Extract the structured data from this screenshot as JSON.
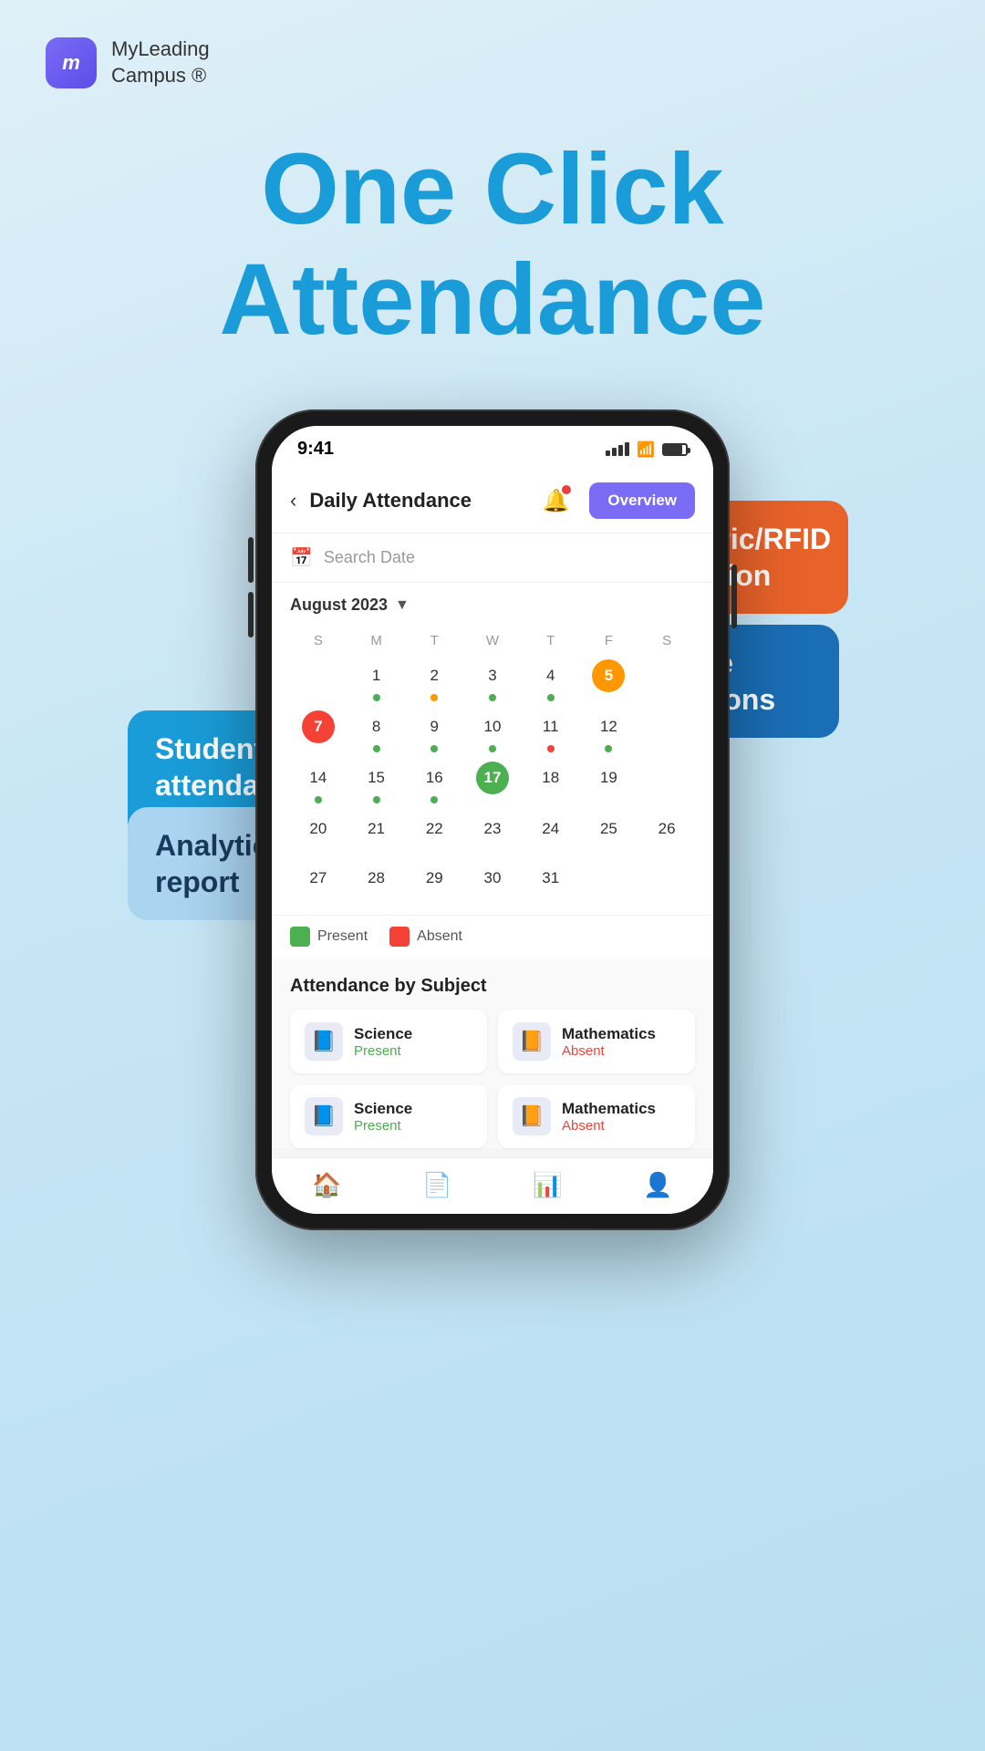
{
  "logo": {
    "icon_letter": "m",
    "text_line1": "MyLeading",
    "text_line2": "Campus ®"
  },
  "hero": {
    "line1": "One Click",
    "line2": "Attendance"
  },
  "phone": {
    "status_time": "9:41",
    "app_title": "Daily Attendance",
    "overview_btn": "Overview",
    "search_placeholder": "Search Date",
    "month_label": "August 2023",
    "day_headers": [
      "S",
      "M",
      "T",
      "W",
      "T",
      "F",
      "S"
    ],
    "legend_present": "Present",
    "legend_absent": "Absent",
    "by_subject_title": "Attendance by Subject",
    "subjects": [
      {
        "name": "Science",
        "status": "Present",
        "status_type": "present"
      },
      {
        "name": "Mathematics",
        "status": "Absent",
        "status_type": "absent"
      },
      {
        "name": "Science",
        "status": "Present",
        "status_type": "present"
      },
      {
        "name": "Mathematics",
        "status": "Absent",
        "status_type": "absent"
      }
    ]
  },
  "bubbles": {
    "biometric": "Biometric/RFID integration",
    "student": "Student attendance tracking",
    "absentee": "Absentee notifications",
    "analytical": "Analytical report"
  },
  "calendar_data": {
    "week1": [
      {
        "day": "",
        "dot": null
      },
      {
        "day": "1",
        "dot": "green"
      },
      {
        "day": "2",
        "dot": "orange"
      },
      {
        "day": "3",
        "dot": "green"
      },
      {
        "day": "4",
        "dot": "green"
      },
      {
        "day": "5",
        "highlight": "orange",
        "dot": null
      },
      {
        "day": "",
        "dot": null
      }
    ],
    "week2": [
      {
        "day": "7",
        "highlight": "red",
        "dot": null
      },
      {
        "day": "8",
        "dot": "green"
      },
      {
        "day": "9",
        "dot": "green"
      },
      {
        "day": "10",
        "dot": "green"
      },
      {
        "day": "11",
        "dot": "red"
      },
      {
        "day": "12",
        "dot": "green"
      },
      {
        "day": "",
        "dot": null
      }
    ],
    "week3": [
      {
        "day": "14",
        "dot": "green"
      },
      {
        "day": "15",
        "dot": "green"
      },
      {
        "day": "16",
        "dot": "green"
      },
      {
        "day": "17",
        "highlight": "green",
        "dot": null
      },
      {
        "day": "18",
        "dot": null
      },
      {
        "day": "19",
        "dot": null
      },
      {
        "day": "",
        "dot": null
      }
    ],
    "week4": [
      {
        "day": "20",
        "dot": null
      },
      {
        "day": "21",
        "dot": null
      },
      {
        "day": "22",
        "dot": null
      },
      {
        "day": "23",
        "dot": null
      },
      {
        "day": "24",
        "dot": null
      },
      {
        "day": "25",
        "dot": null
      },
      {
        "day": "26",
        "dot": null
      }
    ],
    "week5": [
      {
        "day": "27",
        "dot": null
      },
      {
        "day": "28",
        "dot": null
      },
      {
        "day": "29",
        "dot": null
      },
      {
        "day": "30",
        "dot": null
      },
      {
        "day": "31",
        "dot": null
      },
      {
        "day": "",
        "dot": null
      },
      {
        "day": "",
        "dot": null
      }
    ]
  }
}
